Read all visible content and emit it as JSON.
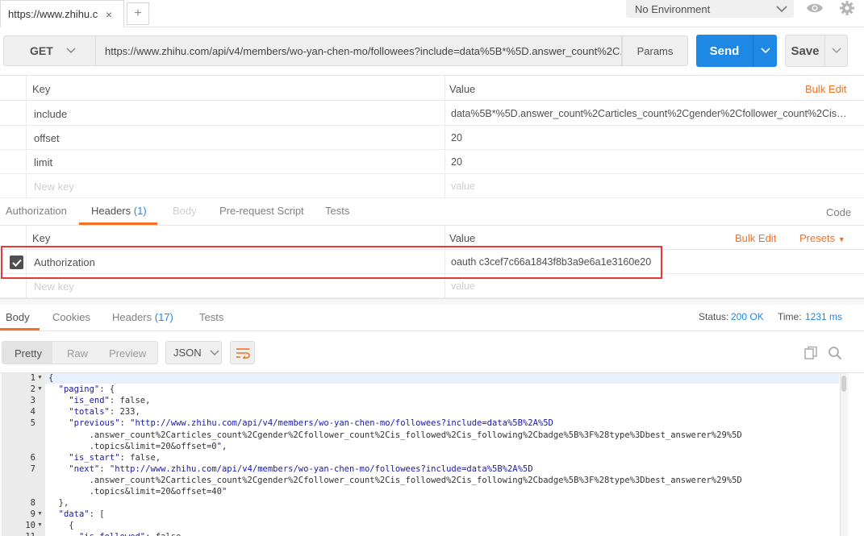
{
  "tabbar": {
    "tab_label": "https://www.zhihu.c",
    "close": "×",
    "new_tab": "+",
    "environment": "No Environment"
  },
  "request": {
    "method": "GET",
    "url": "https://www.zhihu.com/api/v4/members/wo-yan-chen-mo/followees?include=data%5B*%5D.answer_count%2C...",
    "params_label": "Params",
    "send_label": "Send",
    "save_label": "Save"
  },
  "params_table": {
    "key_header": "Key",
    "value_header": "Value",
    "bulk_edit": "Bulk Edit",
    "rows": [
      {
        "key": "include",
        "value": "data%5B*%5D.answer_count%2Carticles_count%2Cgender%2Cfollower_count%2Cis_fo..."
      },
      {
        "key": "offset",
        "value": "20"
      },
      {
        "key": "limit",
        "value": "20"
      }
    ],
    "new_key_placeholder": "New key",
    "value_placeholder": "value"
  },
  "request_tabs": {
    "authorization": "Authorization",
    "headers": "Headers",
    "headers_count": "(1)",
    "body": "Body",
    "prerequest": "Pre-request Script",
    "tests": "Tests",
    "code": "Code"
  },
  "headers_table": {
    "key_header": "Key",
    "value_header": "Value",
    "bulk_edit": "Bulk Edit",
    "presets": "Presets",
    "rows": [
      {
        "key": "Authorization",
        "value": "oauth c3cef7c66a1843f8b3a9e6a1e3160e20",
        "checked": true
      }
    ],
    "new_key_placeholder": "New key",
    "value_placeholder": "value"
  },
  "response_tabs": {
    "body": "Body",
    "cookies": "Cookies",
    "headers": "Headers",
    "headers_count": "(17)",
    "tests": "Tests",
    "status_label": "Status:",
    "status_value": "200 OK",
    "time_label": "Time:",
    "time_value": "1231 ms"
  },
  "body_toolbar": {
    "pretty": "Pretty",
    "raw": "Raw",
    "preview": "Preview",
    "format": "JSON"
  },
  "code_lines": [
    {
      "n": "1",
      "fold": true,
      "text": "{"
    },
    {
      "n": "2",
      "fold": true,
      "text": "  \"paging\": {"
    },
    {
      "n": "3",
      "fold": false,
      "text": "    \"is_end\": false,"
    },
    {
      "n": "4",
      "fold": false,
      "text": "    \"totals\": 233,"
    },
    {
      "n": "5",
      "fold": false,
      "text": "    \"previous\": \"http://www.zhihu.com/api/v4/members/wo-yan-chen-mo/followees?include=data%5B%2A%5D"
    },
    {
      "n": "",
      "fold": false,
      "text": "        .answer_count%2Carticles_count%2Cgender%2Cfollower_count%2Cis_followed%2Cis_following%2Cbadge%5B%3F%28type%3Dbest_answerer%29%5D"
    },
    {
      "n": "",
      "fold": false,
      "text": "        .topics&limit=20&offset=0\","
    },
    {
      "n": "6",
      "fold": false,
      "text": "    \"is_start\": false,"
    },
    {
      "n": "7",
      "fold": false,
      "text": "    \"next\": \"http://www.zhihu.com/api/v4/members/wo-yan-chen-mo/followees?include=data%5B%2A%5D"
    },
    {
      "n": "",
      "fold": false,
      "text": "        .answer_count%2Carticles_count%2Cgender%2Cfollower_count%2Cis_followed%2Cis_following%2Cbadge%5B%3F%28type%3Dbest_answerer%29%5D"
    },
    {
      "n": "",
      "fold": false,
      "text": "        .topics&limit=20&offset=40\""
    },
    {
      "n": "8",
      "fold": false,
      "text": "  },"
    },
    {
      "n": "9",
      "fold": true,
      "text": "  \"data\": ["
    },
    {
      "n": "10",
      "fold": true,
      "text": "    {"
    },
    {
      "n": "11",
      "fold": false,
      "text": "      \"is_followed\": false,"
    }
  ],
  "colors": {
    "accent_blue": "#1e88e5",
    "orange": "#f47023",
    "highlight_red": "#e53935"
  }
}
